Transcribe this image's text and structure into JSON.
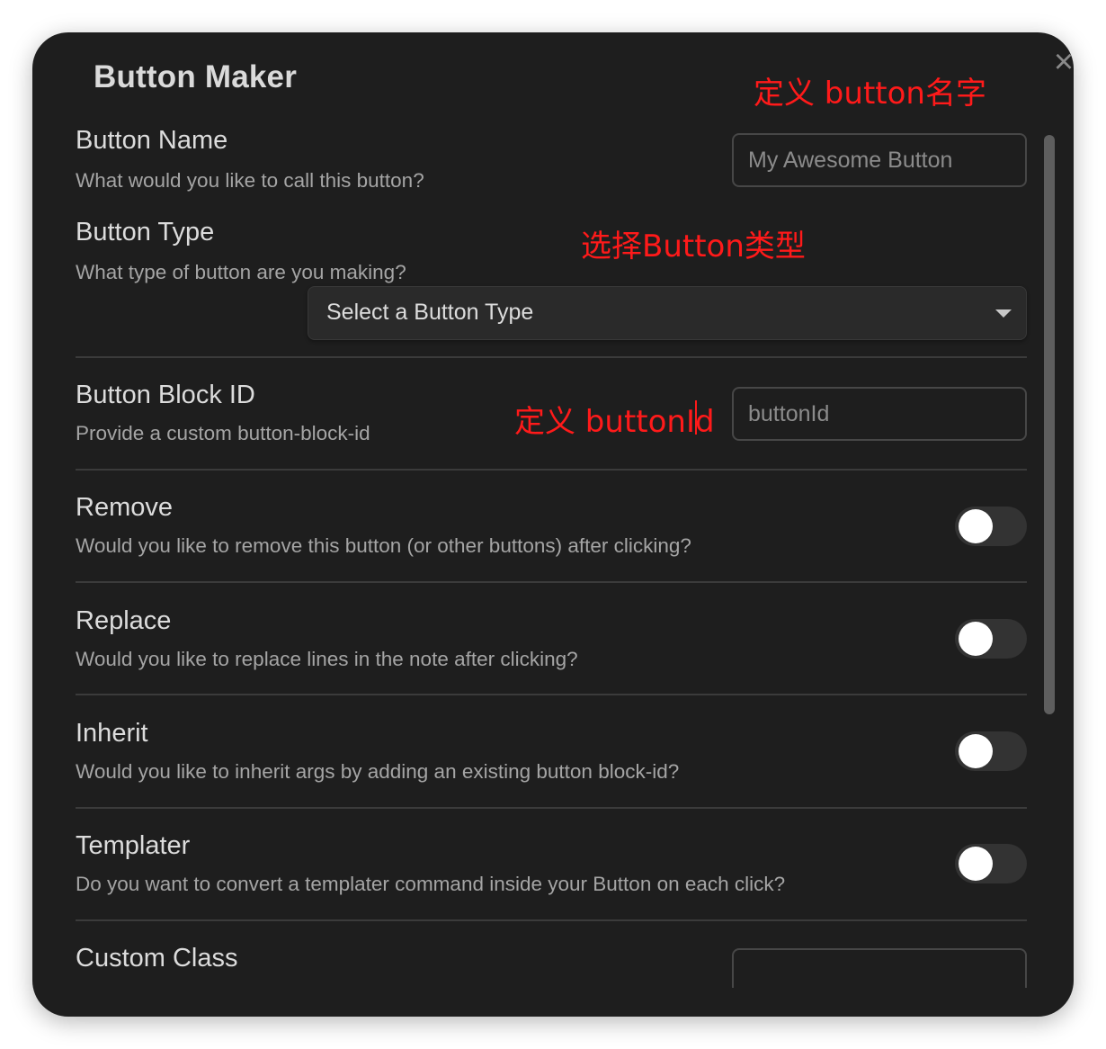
{
  "modal": {
    "title": "Button Maker",
    "close_icon": "close-icon"
  },
  "settings": {
    "button_name": {
      "name": "Button Name",
      "desc": "What would you like to call this button?",
      "placeholder": "My Awesome Button"
    },
    "button_type": {
      "name": "Button Type",
      "desc": "What type of button are you making?",
      "selected": "Select a Button Type"
    },
    "block_id": {
      "name": "Button Block ID",
      "desc": "Provide a custom button-block-id",
      "placeholder": "buttonId"
    },
    "remove": {
      "name": "Remove",
      "desc": "Would you like to remove this button (or other buttons) after clicking?",
      "enabled": false
    },
    "replace": {
      "name": "Replace",
      "desc": "Would you like to replace lines in the note after clicking?",
      "enabled": false
    },
    "inherit": {
      "name": "Inherit",
      "desc": "Would you like to inherit args by adding an existing button block-id?",
      "enabled": false
    },
    "templater": {
      "name": "Templater",
      "desc": "Do you want to convert a templater command inside your Button on each click?",
      "enabled": false
    },
    "custom_class": {
      "name": "Custom Class"
    }
  },
  "annotations": {
    "name_note": "定义 button名字",
    "type_note": "选择Button类型",
    "id_note": "定义 buttonId"
  },
  "colors": {
    "modal_bg": "#1e1e1e",
    "annotation": "#ff1a1a",
    "toggle_off": "#333333"
  }
}
